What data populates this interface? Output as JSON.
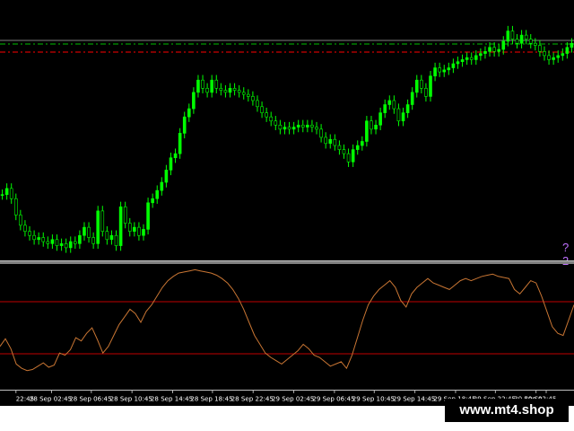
{
  "price_chart": {
    "upper_level_color": "#00c000",
    "lower_level_color": "#ff0000",
    "candle_up_color": "#00ff00",
    "candle_wick_color": "#00ff00",
    "value_label_partial": "?2",
    "value_label_color": "#c071ff",
    "close_series": [
      {
        "t": 0,
        "c": 0.3
      },
      {
        "t": 1,
        "c": 0.33
      },
      {
        "t": 2,
        "c": 0.28
      },
      {
        "t": 3,
        "c": 0.2
      },
      {
        "t": 4,
        "c": 0.15
      },
      {
        "t": 5,
        "c": 0.12
      },
      {
        "t": 6,
        "c": 0.1
      },
      {
        "t": 7,
        "c": 0.08
      },
      {
        "t": 8,
        "c": 0.09
      },
      {
        "t": 9,
        "c": 0.07
      },
      {
        "t": 10,
        "c": 0.06
      },
      {
        "t": 11,
        "c": 0.08
      },
      {
        "t": 12,
        "c": 0.05
      },
      {
        "t": 13,
        "c": 0.06
      },
      {
        "t": 14,
        "c": 0.04
      },
      {
        "t": 15,
        "c": 0.07
      },
      {
        "t": 16,
        "c": 0.06
      },
      {
        "t": 17,
        "c": 0.1
      },
      {
        "t": 18,
        "c": 0.14
      },
      {
        "t": 19,
        "c": 0.09
      },
      {
        "t": 20,
        "c": 0.06
      },
      {
        "t": 21,
        "c": 0.22
      },
      {
        "t": 22,
        "c": 0.12
      },
      {
        "t": 23,
        "c": 0.08
      },
      {
        "t": 24,
        "c": 0.1
      },
      {
        "t": 25,
        "c": 0.05
      },
      {
        "t": 26,
        "c": 0.24
      },
      {
        "t": 27,
        "c": 0.16
      },
      {
        "t": 28,
        "c": 0.12
      },
      {
        "t": 29,
        "c": 0.14
      },
      {
        "t": 30,
        "c": 0.1
      },
      {
        "t": 31,
        "c": 0.13
      },
      {
        "t": 32,
        "c": 0.26
      },
      {
        "t": 33,
        "c": 0.28
      },
      {
        "t": 34,
        "c": 0.32
      },
      {
        "t": 35,
        "c": 0.36
      },
      {
        "t": 36,
        "c": 0.42
      },
      {
        "t": 37,
        "c": 0.48
      },
      {
        "t": 38,
        "c": 0.5
      },
      {
        "t": 39,
        "c": 0.6
      },
      {
        "t": 40,
        "c": 0.68
      },
      {
        "t": 41,
        "c": 0.72
      },
      {
        "t": 42,
        "c": 0.8
      },
      {
        "t": 43,
        "c": 0.86
      },
      {
        "t": 44,
        "c": 0.82
      },
      {
        "t": 45,
        "c": 0.8
      },
      {
        "t": 46,
        "c": 0.86
      },
      {
        "t": 47,
        "c": 0.82
      },
      {
        "t": 48,
        "c": 0.81
      },
      {
        "t": 49,
        "c": 0.8
      },
      {
        "t": 50,
        "c": 0.82
      },
      {
        "t": 51,
        "c": 0.81
      },
      {
        "t": 52,
        "c": 0.8
      },
      {
        "t": 53,
        "c": 0.79
      },
      {
        "t": 54,
        "c": 0.78
      },
      {
        "t": 55,
        "c": 0.76
      },
      {
        "t": 56,
        "c": 0.73
      },
      {
        "t": 57,
        "c": 0.7
      },
      {
        "t": 58,
        "c": 0.68
      },
      {
        "t": 59,
        "c": 0.66
      },
      {
        "t": 60,
        "c": 0.64
      },
      {
        "t": 61,
        "c": 0.62
      },
      {
        "t": 62,
        "c": 0.63
      },
      {
        "t": 63,
        "c": 0.62
      },
      {
        "t": 64,
        "c": 0.63
      },
      {
        "t": 65,
        "c": 0.64
      },
      {
        "t": 66,
        "c": 0.63
      },
      {
        "t": 67,
        "c": 0.64
      },
      {
        "t": 68,
        "c": 0.63
      },
      {
        "t": 69,
        "c": 0.62
      },
      {
        "t": 70,
        "c": 0.58
      },
      {
        "t": 71,
        "c": 0.55
      },
      {
        "t": 72,
        "c": 0.57
      },
      {
        "t": 73,
        "c": 0.54
      },
      {
        "t": 74,
        "c": 0.52
      },
      {
        "t": 75,
        "c": 0.5
      },
      {
        "t": 76,
        "c": 0.46
      },
      {
        "t": 77,
        "c": 0.52
      },
      {
        "t": 78,
        "c": 0.54
      },
      {
        "t": 79,
        "c": 0.56
      },
      {
        "t": 80,
        "c": 0.66
      },
      {
        "t": 81,
        "c": 0.62
      },
      {
        "t": 82,
        "c": 0.64
      },
      {
        "t": 83,
        "c": 0.7
      },
      {
        "t": 84,
        "c": 0.74
      },
      {
        "t": 85,
        "c": 0.76
      },
      {
        "t": 86,
        "c": 0.72
      },
      {
        "t": 87,
        "c": 0.66
      },
      {
        "t": 88,
        "c": 0.7
      },
      {
        "t": 89,
        "c": 0.74
      },
      {
        "t": 90,
        "c": 0.8
      },
      {
        "t": 91,
        "c": 0.86
      },
      {
        "t": 92,
        "c": 0.82
      },
      {
        "t": 93,
        "c": 0.78
      },
      {
        "t": 94,
        "c": 0.88
      },
      {
        "t": 95,
        "c": 0.92
      },
      {
        "t": 96,
        "c": 0.9
      },
      {
        "t": 97,
        "c": 0.91
      },
      {
        "t": 98,
        "c": 0.92
      },
      {
        "t": 99,
        "c": 0.94
      },
      {
        "t": 100,
        "c": 0.95
      },
      {
        "t": 101,
        "c": 0.96
      },
      {
        "t": 102,
        "c": 0.97
      },
      {
        "t": 103,
        "c": 0.96
      },
      {
        "t": 104,
        "c": 0.98
      },
      {
        "t": 105,
        "c": 0.99
      },
      {
        "t": 106,
        "c": 1.0
      },
      {
        "t": 107,
        "c": 1.02
      },
      {
        "t": 108,
        "c": 1.0
      },
      {
        "t": 109,
        "c": 1.01
      },
      {
        "t": 110,
        "c": 1.05
      },
      {
        "t": 111,
        "c": 1.1
      },
      {
        "t": 112,
        "c": 1.06
      },
      {
        "t": 113,
        "c": 1.04
      },
      {
        "t": 114,
        "c": 1.08
      },
      {
        "t": 115,
        "c": 1.06
      },
      {
        "t": 116,
        "c": 1.04
      },
      {
        "t": 117,
        "c": 1.03
      },
      {
        "t": 118,
        "c": 1.0
      },
      {
        "t": 119,
        "c": 0.98
      },
      {
        "t": 120,
        "c": 0.96
      },
      {
        "t": 121,
        "c": 0.97
      },
      {
        "t": 122,
        "c": 0.98
      },
      {
        "t": 123,
        "c": 0.99
      },
      {
        "t": 124,
        "c": 1.02
      },
      {
        "t": 125,
        "c": 1.04
      }
    ],
    "price_min": 0,
    "price_max": 1.12
  },
  "indicator": {
    "line_color": "#c87533",
    "level_color": "#c00000",
    "values": [
      0.28,
      0.35,
      0.26,
      0.12,
      0.08,
      0.06,
      0.07,
      0.1,
      0.13,
      0.09,
      0.11,
      0.22,
      0.2,
      0.25,
      0.36,
      0.33,
      0.4,
      0.45,
      0.34,
      0.22,
      0.28,
      0.38,
      0.48,
      0.55,
      0.62,
      0.58,
      0.5,
      0.6,
      0.66,
      0.74,
      0.82,
      0.88,
      0.92,
      0.95,
      0.96,
      0.97,
      0.98,
      0.97,
      0.96,
      0.95,
      0.93,
      0.9,
      0.86,
      0.8,
      0.72,
      0.62,
      0.5,
      0.38,
      0.3,
      0.22,
      0.18,
      0.15,
      0.12,
      0.16,
      0.2,
      0.24,
      0.3,
      0.26,
      0.2,
      0.18,
      0.14,
      0.1,
      0.12,
      0.14,
      0.08,
      0.2,
      0.36,
      0.52,
      0.66,
      0.74,
      0.8,
      0.84,
      0.88,
      0.82,
      0.7,
      0.64,
      0.76,
      0.82,
      0.86,
      0.9,
      0.86,
      0.84,
      0.82,
      0.8,
      0.84,
      0.88,
      0.9,
      0.88,
      0.9,
      0.92,
      0.93,
      0.94,
      0.92,
      0.91,
      0.9,
      0.8,
      0.76,
      0.82,
      0.88,
      0.86,
      0.74,
      0.6,
      0.46,
      0.4,
      0.38,
      0.52,
      0.66
    ],
    "upper_level": 0.7,
    "lower_level": 0.3
  },
  "time_axis": {
    "labels": [
      "22:45",
      "28 Sep 02:45",
      "28 Sep 06:45",
      "28 Sep 10:45",
      "28 Sep 14:45",
      "28 Sep 18:45",
      "28 Sep 22:45",
      "29 Sep 02:45",
      "29 Sep 06:45",
      "29 Sep 10:45",
      "29 Sep 14:45",
      "29 Sep 18:45",
      "29 Sep 22:45",
      "30 Sep 02:45",
      "30 Se"
    ],
    "text_color": "#ffffff"
  },
  "watermark": {
    "text": "www.mt4.shop"
  }
}
